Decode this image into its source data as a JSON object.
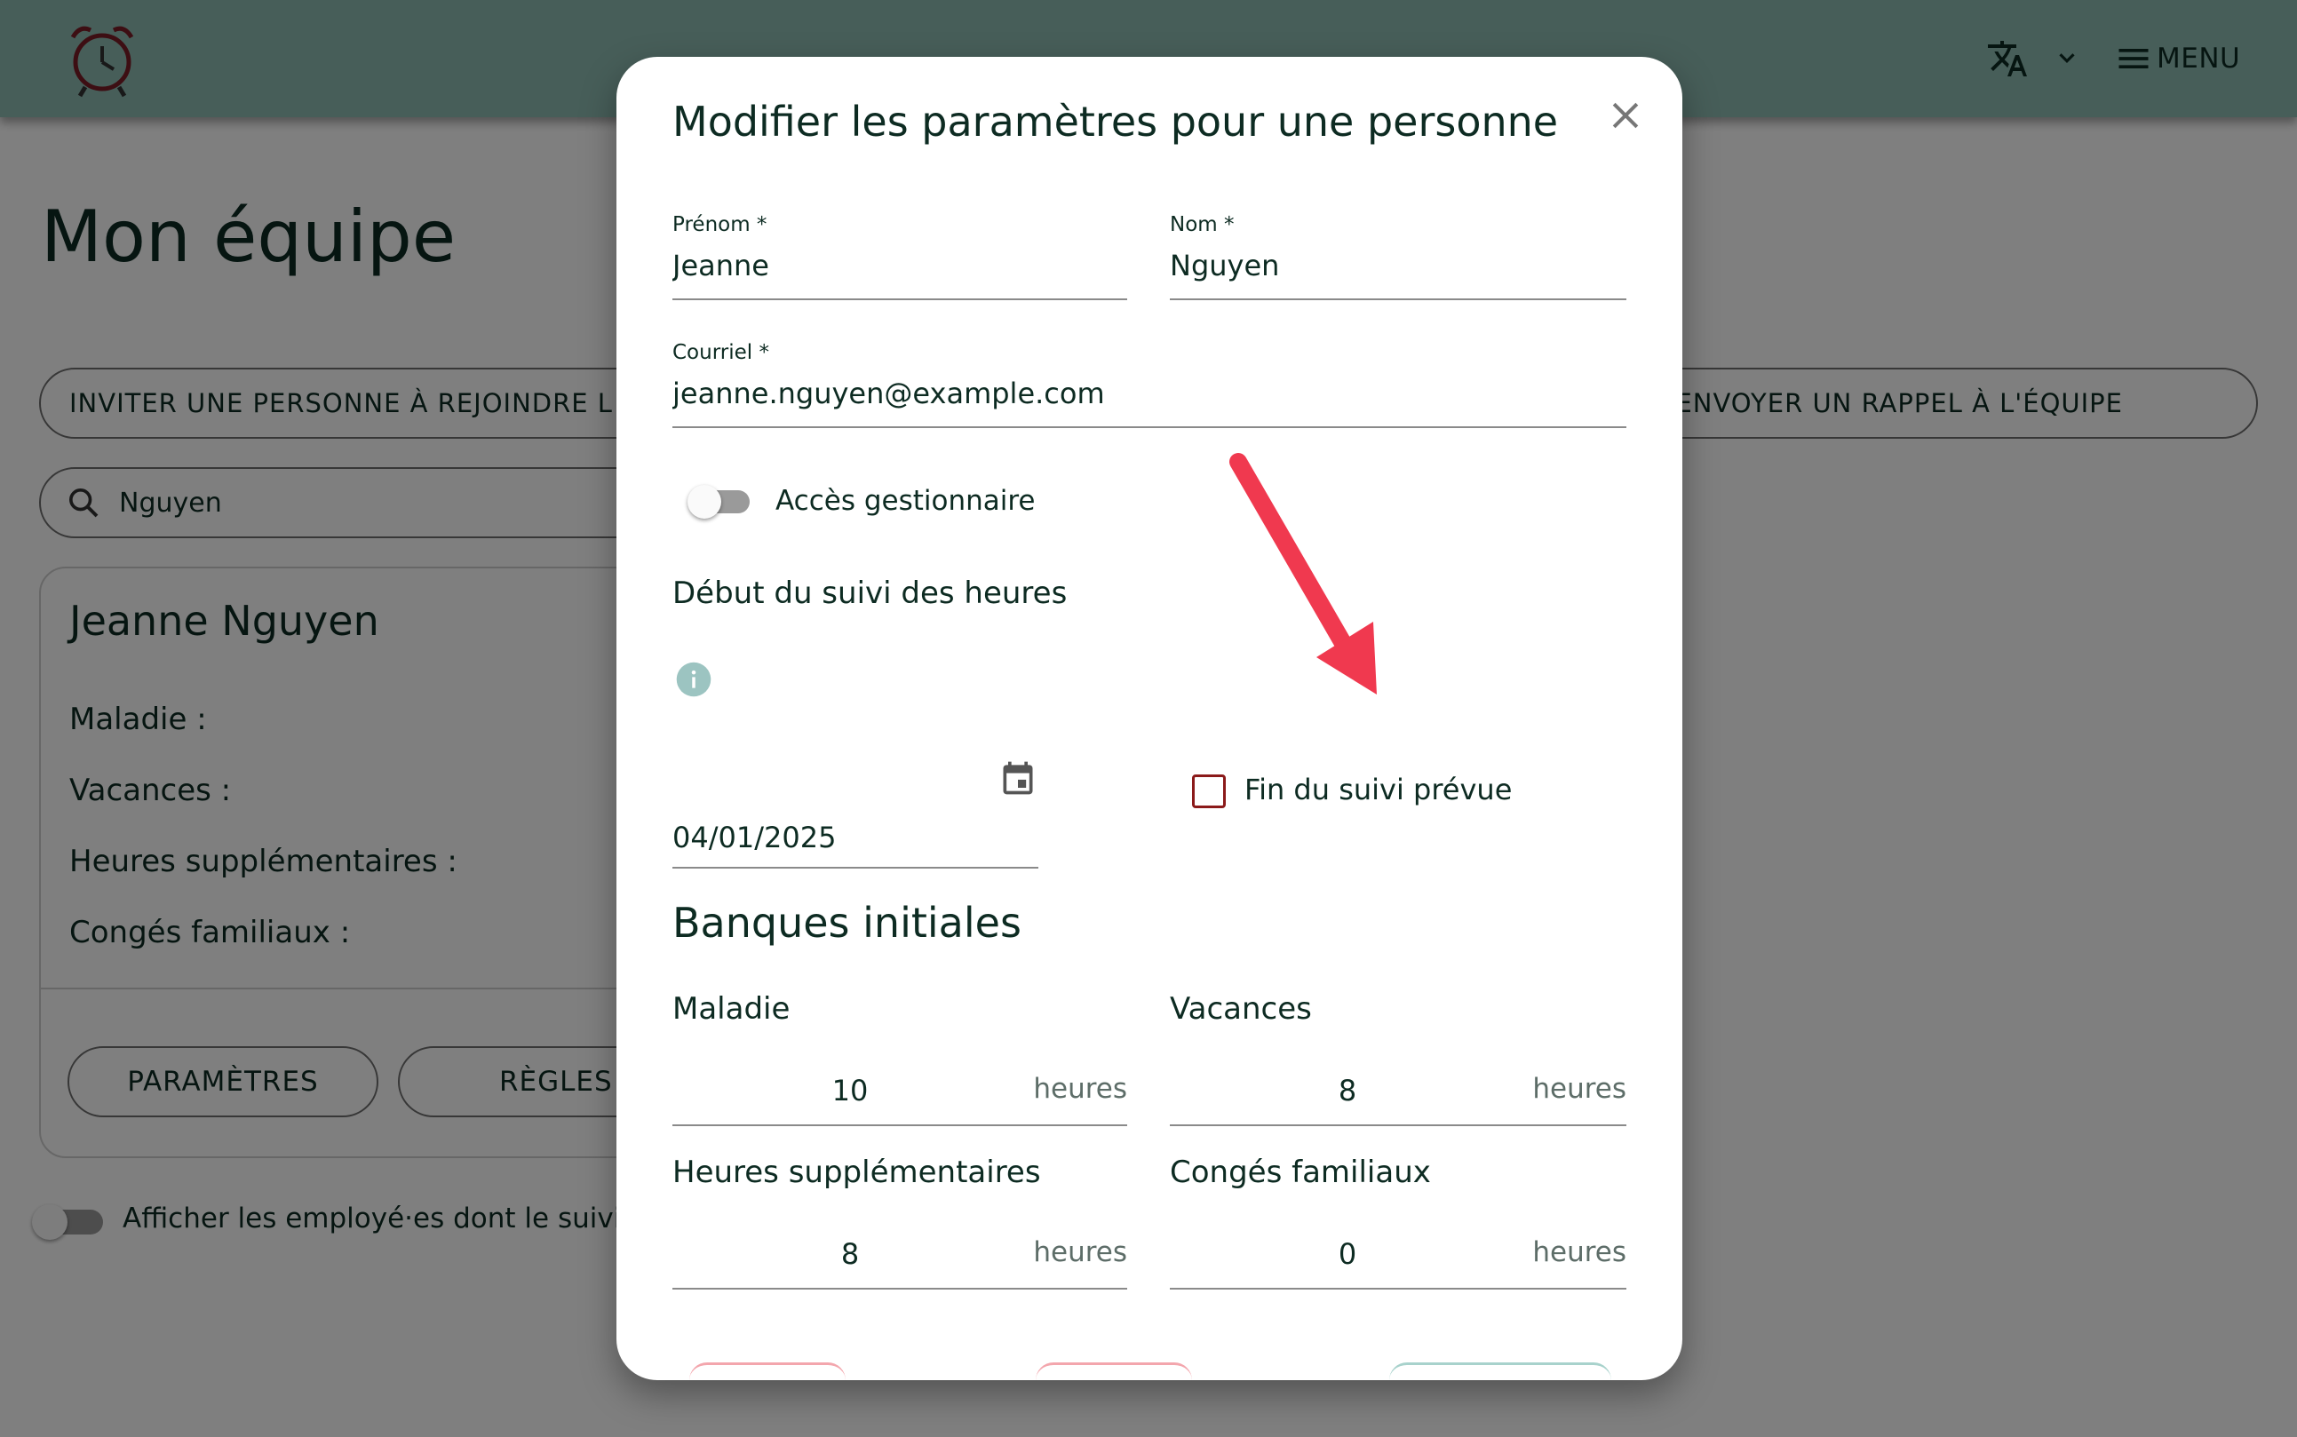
{
  "header": {
    "logo_icon": "alarm-clock-icon",
    "translate_icon": "translate-icon",
    "menu_label": "MENU"
  },
  "page": {
    "title": "Mon équipe",
    "invite_label": "INVITER UNE PERSONNE À REJOINDRE L",
    "reminder_label": "ENVOYER UN RAPPEL À L'ÉQUIPE",
    "search_value": "Nguyen"
  },
  "card": {
    "name": "Jeanne Nguyen",
    "rows": [
      "Maladie :",
      "Vacances :",
      "Heures supplémentaires :",
      "Congés familiaux :"
    ],
    "params_label": "PARAMÈTRES",
    "rules_label": "RÈGLES"
  },
  "footer_toggle_label": "Afficher les employé·es dont le suivi est",
  "dialog": {
    "title": "Modifier les paramètres pour une personne",
    "prenom_label": "Prénom *",
    "prenom_value": "Jeanne",
    "nom_label": "Nom *",
    "nom_value": "Nguyen",
    "courriel_label": "Courriel *",
    "courriel_value": "jeanne.nguyen@example.com",
    "manager_label": "Accès gestionnaire",
    "manager_enabled": false,
    "start_section": "Début du suivi des heures",
    "start_date": "04/01/2025",
    "end_planned_label": "Fin du suivi prévue",
    "end_planned_checked": false,
    "banks_title": "Banques initiales",
    "banks": [
      {
        "label": "Maladie",
        "value": "10",
        "unit": "heures"
      },
      {
        "label": "Vacances",
        "value": "8",
        "unit": "heures"
      },
      {
        "label": "Heures supplémentaires",
        "value": "8",
        "unit": "heures"
      },
      {
        "label": "Congés familiaux",
        "value": "0",
        "unit": "heures"
      }
    ]
  },
  "colors": {
    "appbar": "#8fbcb3",
    "text": "#0d2b22",
    "checkbox": "#8b1a1a",
    "annotation_arrow": "#f0394f",
    "info": "#9cc4c1"
  }
}
